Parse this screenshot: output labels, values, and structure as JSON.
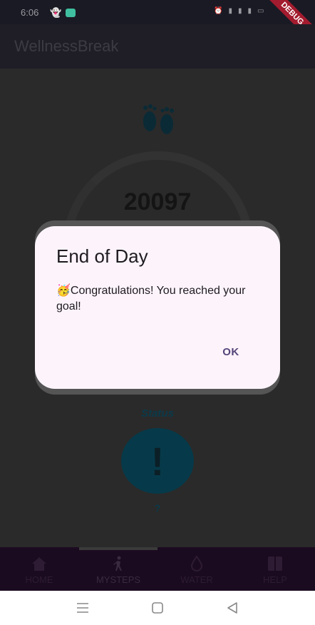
{
  "status_bar": {
    "time": "6:06",
    "right_icons": [
      "alarm-icon",
      "data-icon",
      "signal-icon",
      "signal-icon",
      "battery-icon"
    ]
  },
  "debug_ribbon": "DEBUG",
  "app_bar": {
    "title": "WellnessBreak"
  },
  "main": {
    "steps_count": "20097",
    "status_label": "Status",
    "status_mark": "!",
    "status_value": "?"
  },
  "dialog": {
    "title": "End of Day",
    "emoji": "🥳",
    "message": "Congratulations! You reached your goal!",
    "ok_label": "OK"
  },
  "bottom_nav": {
    "items": [
      {
        "label": "HOME",
        "icon": "home-icon"
      },
      {
        "label": "MYSTEPS",
        "icon": "walk-icon"
      },
      {
        "label": "WATER",
        "icon": "water-drop-icon"
      },
      {
        "label": "HELP",
        "icon": "help-book-icon"
      }
    ],
    "selected": "MYSTEPS"
  },
  "colors": {
    "accent": "#55457a",
    "dialog_bg": "#fdf4fb",
    "status": "#063a4a",
    "nav_bg": "#1b0b20"
  }
}
